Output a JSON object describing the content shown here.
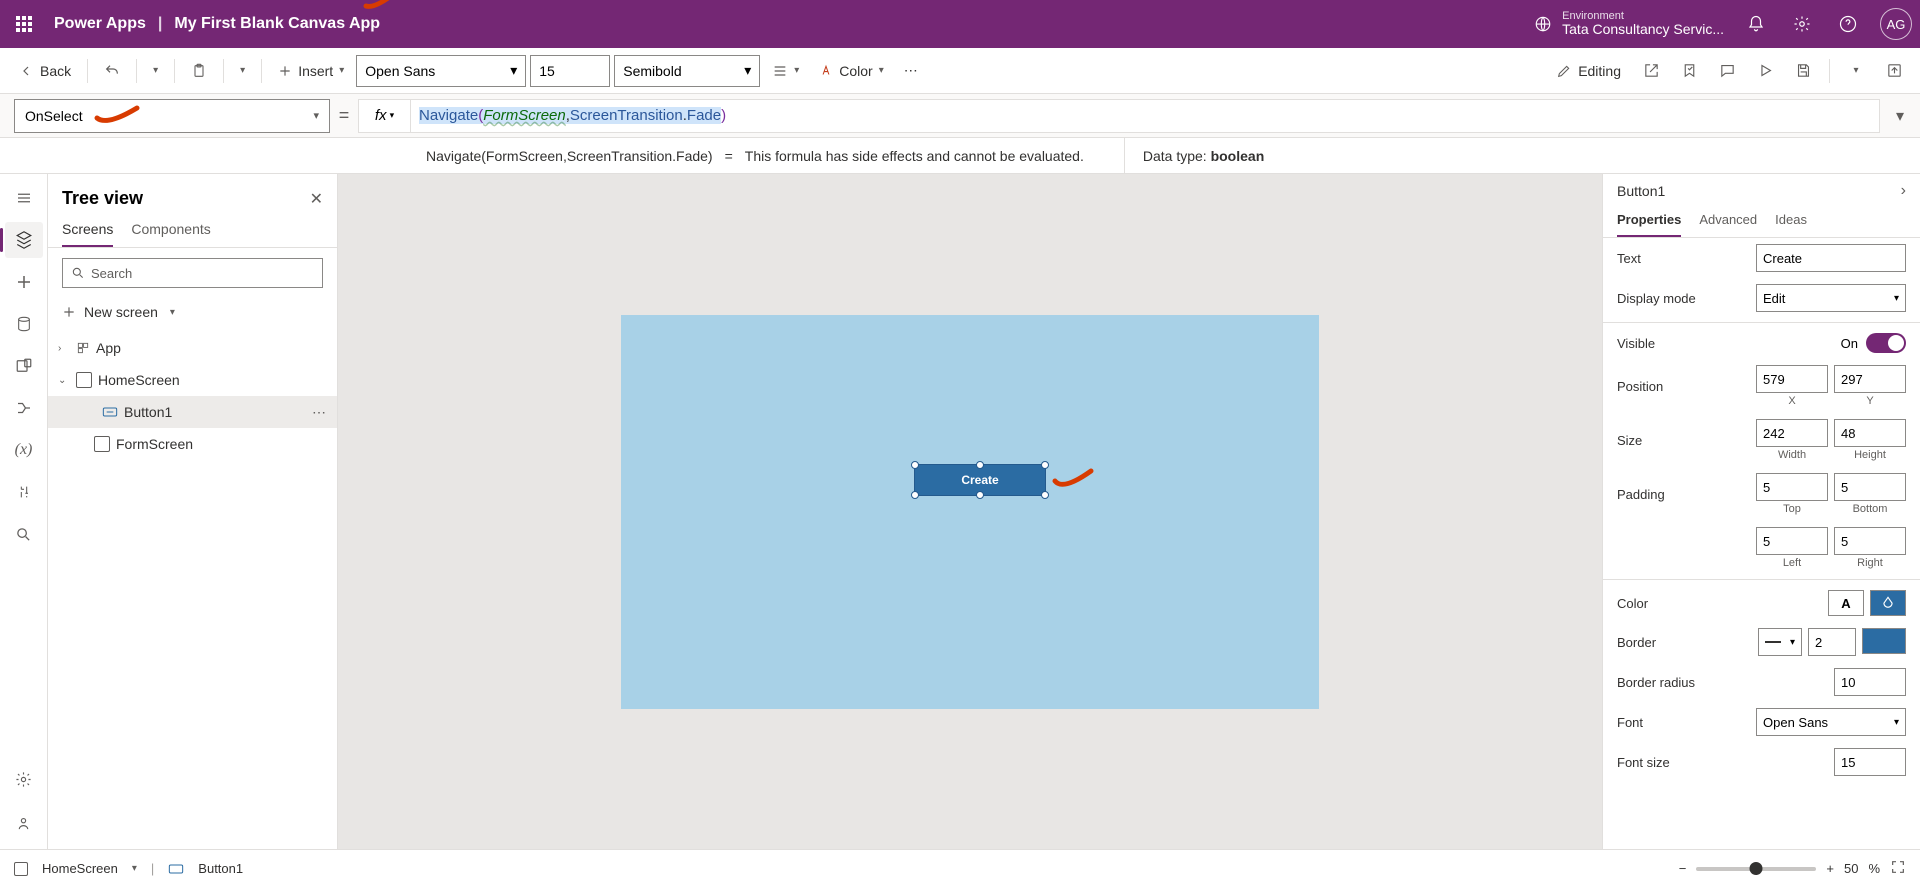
{
  "header": {
    "app_name": "Power Apps",
    "project_name": "My First Blank Canvas App",
    "env_label": "Environment",
    "env_name": "Tata Consultancy Servic...",
    "avatar_initials": "AG"
  },
  "cmdbar": {
    "back": "Back",
    "insert": "Insert",
    "font": "Open Sans",
    "size": "15",
    "weight": "Semibold",
    "color": "Color",
    "editing": "Editing"
  },
  "formula": {
    "property": "OnSelect",
    "fx": "fx",
    "tok_nav": "Navigate",
    "tok_arg": "FormScreen",
    "tok_enum1": "ScreenTransition",
    "tok_enum2": "Fade",
    "hint_expr": "Navigate(FormScreen,ScreenTransition.Fade)",
    "hint_eq": "=",
    "hint_msg": "This formula has side effects and cannot be evaluated.",
    "datatype_label": "Data type:",
    "datatype_value": "boolean"
  },
  "tree": {
    "title": "Tree view",
    "tab_screens": "Screens",
    "tab_components": "Components",
    "search_placeholder": "Search",
    "newscreen": "New screen",
    "app": "App",
    "home": "HomeScreen",
    "button": "Button1",
    "form": "FormScreen"
  },
  "canvas": {
    "button_text": "Create"
  },
  "props": {
    "control_name": "Button1",
    "tab_properties": "Properties",
    "tab_advanced": "Advanced",
    "tab_ideas": "Ideas",
    "text": "Text",
    "text_val": "Create",
    "displaymode": "Display mode",
    "displaymode_val": "Edit",
    "visible": "Visible",
    "visible_val": "On",
    "position": "Position",
    "pos_x": "579",
    "pos_y": "297",
    "sub_x": "X",
    "sub_y": "Y",
    "size": "Size",
    "size_w": "242",
    "size_h": "48",
    "sub_w": "Width",
    "sub_h": "Height",
    "padding": "Padding",
    "pad_t": "5",
    "pad_b": "5",
    "pad_l": "5",
    "pad_r": "5",
    "sub_t": "Top",
    "sub_btm": "Bottom",
    "sub_l": "Left",
    "sub_r": "Right",
    "color": "Color",
    "border": "Border",
    "border_val": "2",
    "borderradius": "Border radius",
    "borderradius_val": "10",
    "font": "Font",
    "font_val": "Open Sans",
    "fontsize": "Font size",
    "fontsize_val": "15"
  },
  "status": {
    "screen": "HomeScreen",
    "control": "Button1",
    "zoom": "50",
    "pct": "%"
  },
  "colors": {
    "brand": "#742774",
    "accent": "#2b6ca3",
    "annotation": "#d83b01"
  }
}
